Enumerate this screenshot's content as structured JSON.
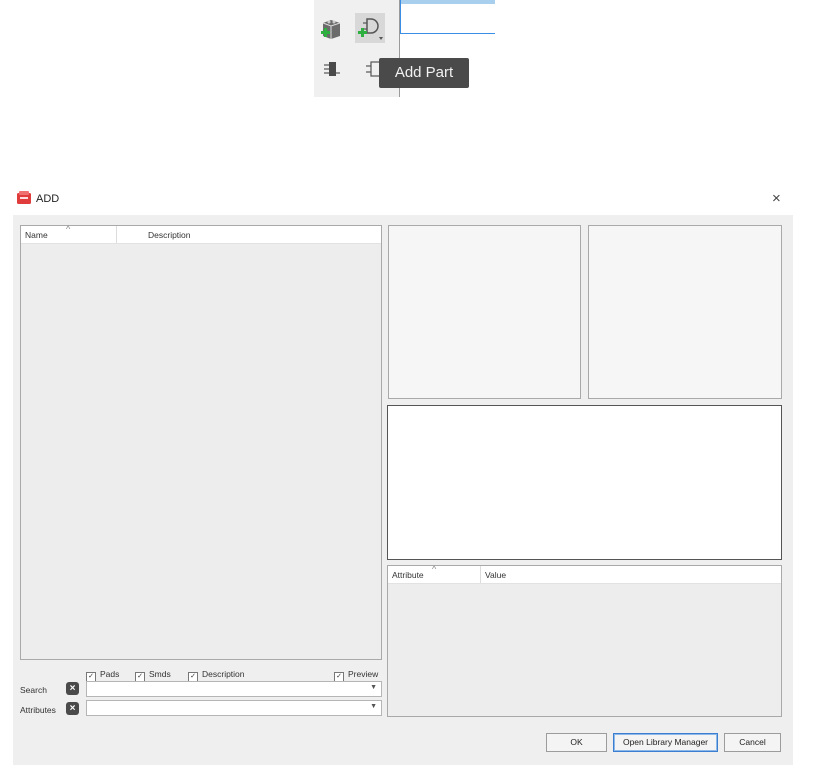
{
  "tooltip": {
    "text": "Add Part"
  },
  "toolbar": {
    "buttons": [
      {
        "icon": "add-library-icon"
      },
      {
        "icon": "add-part-icon"
      },
      {
        "icon": "package-icon"
      },
      {
        "icon": "symbol-icon"
      }
    ]
  },
  "dialog": {
    "title": "ADD",
    "close_glyph": "×",
    "list": {
      "columns": [
        "Name",
        "Description"
      ]
    },
    "attributes_table": {
      "columns": [
        "Attribute",
        "Value"
      ]
    },
    "filters": {
      "pads": {
        "label": "Pads",
        "checked": true
      },
      "smds": {
        "label": "Smds",
        "checked": true
      },
      "description": {
        "label": "Description",
        "checked": true
      },
      "preview": {
        "label": "Preview",
        "checked": true
      }
    },
    "search": {
      "label": "Search",
      "value": ""
    },
    "attributes": {
      "label": "Attributes",
      "value": ""
    },
    "buttons": {
      "ok": "OK",
      "library_manager": "Open Library Manager",
      "cancel": "Cancel"
    },
    "colors": {
      "accent": "#3c7fd0",
      "title_icon": "#e03c3c"
    }
  }
}
